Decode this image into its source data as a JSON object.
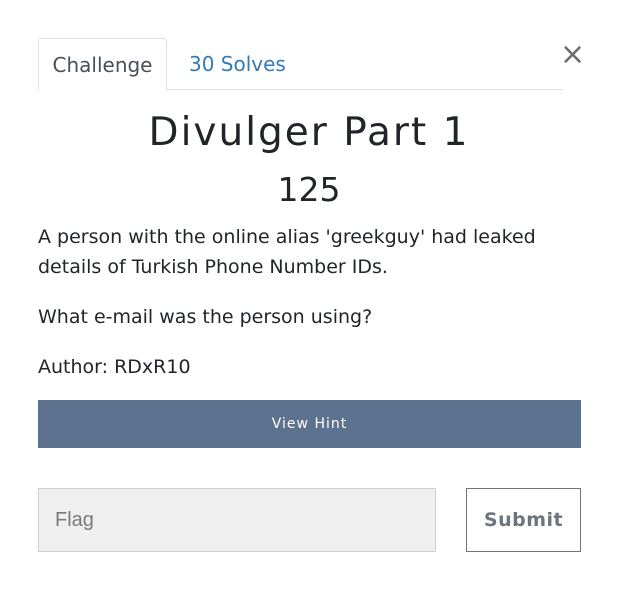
{
  "close_label": "×",
  "tabs": [
    {
      "label": "Challenge"
    },
    {
      "label": "30 Solves"
    }
  ],
  "challenge": {
    "name": "Divulger Part 1",
    "value": "125",
    "description": [
      "A person with the online alias 'greekguy' had leaked details of Turkish Phone Number IDs.",
      "What e-mail was the person using?",
      "Author: RDxR10"
    ]
  },
  "hint_button": "View Hint",
  "flag_input": {
    "placeholder": "Flag",
    "value": ""
  },
  "submit_button": "Submit",
  "colors": {
    "hint_bg": "#5c728f",
    "link": "#337ab7",
    "input_bg": "#efefef"
  }
}
